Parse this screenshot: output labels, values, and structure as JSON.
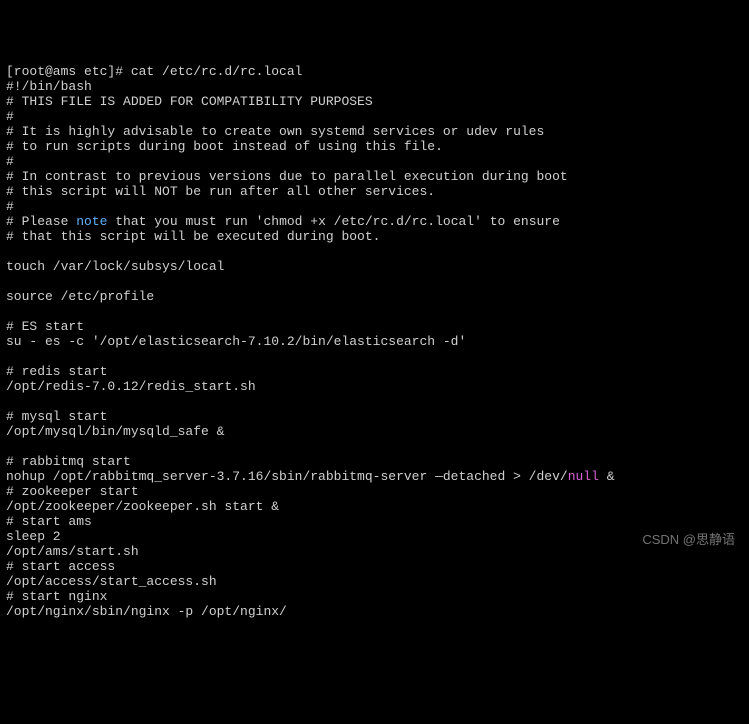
{
  "terminal": {
    "prompt": "[root@ams etc]# cat /etc/rc.d/rc.local",
    "lines": {
      "l1": "#!/bin/bash",
      "l2": "# THIS FILE IS ADDED FOR COMPATIBILITY PURPOSES",
      "l3": "#",
      "l4": "# It is highly advisable to create own systemd services or udev rules",
      "l5": "# to run scripts during boot instead of using this file.",
      "l6": "#",
      "l7": "# In contrast to previous versions due to parallel execution during boot",
      "l8": "# this script will NOT be run after all other services.",
      "l9": "#",
      "l10a": "# Please ",
      "l10b": "note",
      "l10c": " that you must run 'chmod +x /etc/rc.d/rc.local' to ensure",
      "l11": "# that this script will be executed during boot.",
      "l12": "",
      "l13": "touch /var/lock/subsys/local",
      "l14": "",
      "l15": "source /etc/profile",
      "l16": "",
      "l17": "# ES start",
      "l18": "su - es -c '/opt/elasticsearch-7.10.2/bin/elasticsearch -d'",
      "l19": "",
      "l20": "# redis start",
      "l21": "/opt/redis-7.0.12/redis_start.sh",
      "l22": "",
      "l23": "# mysql start",
      "l24": "/opt/mysql/bin/mysqld_safe &",
      "l25": "",
      "l26": "# rabbitmq start",
      "l27a": "nohup /opt/rabbitmq_server-3.7.16/sbin/rabbitmq-server —detached > /dev/",
      "l27b": "null",
      "l27c": " &",
      "l28": "# zookeeper start",
      "l29": "/opt/zookeeper/zookeeper.sh start &",
      "l30": "# start ams",
      "l31": "sleep 2",
      "l32": "/opt/ams/start.sh",
      "l33": "# start access",
      "l34": "/opt/access/start_access.sh",
      "l35": "# start nginx",
      "l36": "/opt/nginx/sbin/nginx -p /opt/nginx/"
    }
  },
  "watermark": "CSDN @思静语"
}
